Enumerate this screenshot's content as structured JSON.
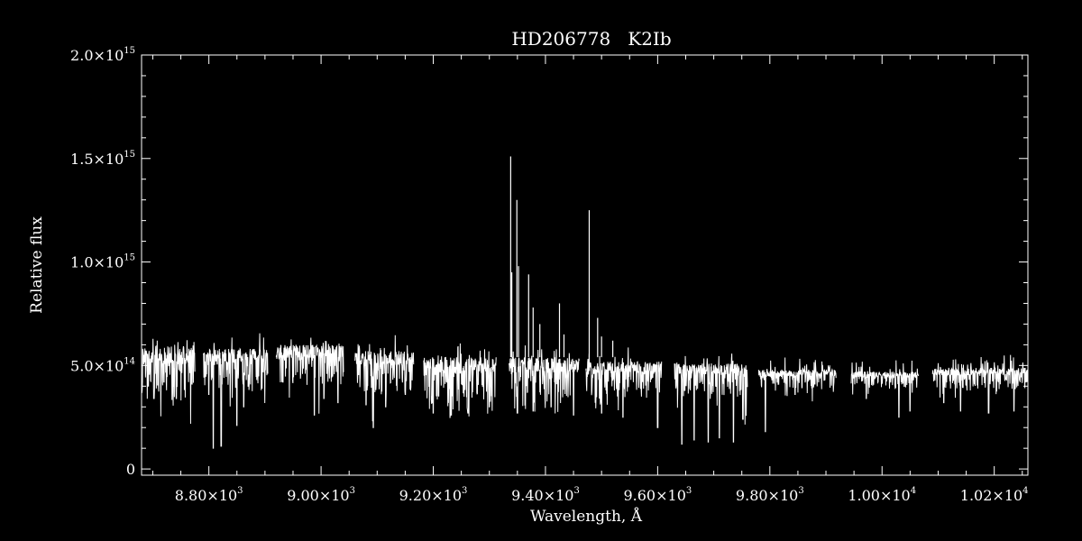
{
  "chart_data": {
    "type": "line",
    "title": "HD206778   K2Ib",
    "xlabel": "Wavelength, Å",
    "ylabel": "Relative flux",
    "xlim": [
      8680,
      10260
    ],
    "ylim": [
      -30000000000000,
      2000000000000000
    ],
    "grid": false,
    "colors": {
      "background": "#000000",
      "foreground": "#ffffff"
    },
    "x_ticks": [
      {
        "value": 8800,
        "mantissa": "8.80×10",
        "exponent": "3"
      },
      {
        "value": 9000,
        "mantissa": "9.00×10",
        "exponent": "3"
      },
      {
        "value": 9200,
        "mantissa": "9.20×10",
        "exponent": "3"
      },
      {
        "value": 9400,
        "mantissa": "9.40×10",
        "exponent": "3"
      },
      {
        "value": 9600,
        "mantissa": "9.60×10",
        "exponent": "3"
      },
      {
        "value": 9800,
        "mantissa": "9.80×10",
        "exponent": "3"
      },
      {
        "value": 10000,
        "mantissa": "1.00×10",
        "exponent": "4"
      },
      {
        "value": 10200,
        "mantissa": "1.02×10",
        "exponent": "4"
      }
    ],
    "y_ticks": [
      {
        "value": 0,
        "mantissa": "0",
        "exponent": ""
      },
      {
        "value": 500000000000000,
        "mantissa": "5.0×10",
        "exponent": "14"
      },
      {
        "value": 1000000000000000,
        "mantissa": "1.0×10",
        "exponent": "15"
      },
      {
        "value": 1500000000000000,
        "mantissa": "1.5×10",
        "exponent": "15"
      },
      {
        "value": 2000000000000000,
        "mantissa": "2.0×10",
        "exponent": "15"
      }
    ],
    "series": [
      {
        "segments": [
          {
            "x_start": 8680,
            "x_end": 8775,
            "continuum": 590000000000000,
            "low": 380000000000000,
            "absorption": [
              {
                "x": 8692,
                "depth": 400000000000000
              },
              {
                "x": 8702,
                "depth": 340000000000000
              },
              {
                "x": 8720,
                "depth": 420000000000000
              },
              {
                "x": 8742,
                "depth": 340000000000000
              },
              {
                "x": 8770,
                "depth": 410000000000000
              }
            ]
          },
          {
            "x_start": 8790,
            "x_end": 8905,
            "continuum": 580000000000000,
            "low": 420000000000000,
            "absorption": [
              {
                "x": 8800,
                "depth": 360000000000000
              },
              {
                "x": 8808,
                "depth": 100000000000000
              },
              {
                "x": 8822,
                "depth": 110000000000000
              },
              {
                "x": 8850,
                "depth": 210000000000000
              },
              {
                "x": 8862,
                "depth": 300000000000000
              }
            ]
          },
          {
            "x_start": 8920,
            "x_end": 9040,
            "continuum": 600000000000000,
            "low": 440000000000000,
            "absorption": [
              {
                "x": 8932,
                "depth": 420000000000000
              },
              {
                "x": 8988,
                "depth": 260000000000000
              },
              {
                "x": 9005,
                "depth": 340000000000000
              },
              {
                "x": 9030,
                "depth": 320000000000000
              }
            ]
          },
          {
            "x_start": 9060,
            "x_end": 9165,
            "continuum": 570000000000000,
            "low": 400000000000000,
            "absorption": [
              {
                "x": 9080,
                "depth": 310000000000000
              },
              {
                "x": 9093,
                "depth": 200000000000000
              },
              {
                "x": 9115,
                "depth": 300000000000000
              },
              {
                "x": 9150,
                "depth": 360000000000000
              }
            ]
          },
          {
            "x_start": 9183,
            "x_end": 9312,
            "continuum": 540000000000000,
            "low": 340000000000000,
            "absorption": [
              {
                "x": 9200,
                "depth": 270000000000000
              },
              {
                "x": 9232,
                "depth": 260000000000000
              },
              {
                "x": 9262,
                "depth": 270000000000000
              },
              {
                "x": 9300,
                "depth": 300000000000000
              }
            ]
          },
          {
            "x_start": 9335,
            "x_end": 9460,
            "continuum": 540000000000000,
            "low": 350000000000000,
            "absorption": [
              {
                "x": 9350,
                "depth": 270000000000000
              },
              {
                "x": 9378,
                "depth": 280000000000000
              },
              {
                "x": 9410,
                "depth": 300000000000000
              },
              {
                "x": 9450,
                "depth": 260000000000000
              }
            ]
          },
          {
            "x_start": 9472,
            "x_end": 9607,
            "continuum": 520000000000000,
            "low": 380000000000000,
            "absorption": [
              {
                "x": 9500,
                "depth": 270000000000000
              },
              {
                "x": 9538,
                "depth": 250000000000000
              },
              {
                "x": 9600,
                "depth": 200000000000000
              }
            ]
          },
          {
            "x_start": 9630,
            "x_end": 9760,
            "continuum": 510000000000000,
            "low": 380000000000000,
            "absorption": [
              {
                "x": 9643,
                "depth": 120000000000000
              },
              {
                "x": 9665,
                "depth": 140000000000000
              },
              {
                "x": 9690,
                "depth": 130000000000000
              },
              {
                "x": 9710,
                "depth": 150000000000000
              },
              {
                "x": 9735,
                "depth": 130000000000000
              },
              {
                "x": 9752,
                "depth": 240000000000000
              }
            ]
          },
          {
            "x_start": 9780,
            "x_end": 9918,
            "continuum": 480000000000000,
            "low": 400000000000000,
            "absorption": [
              {
                "x": 9792,
                "depth": 180000000000000
              },
              {
                "x": 9845,
                "depth": 360000000000000
              }
            ]
          },
          {
            "x_start": 9945,
            "x_end": 10065,
            "continuum": 470000000000000,
            "low": 400000000000000,
            "absorption": [
              {
                "x": 9972,
                "depth": 340000000000000
              },
              {
                "x": 10030,
                "depth": 250000000000000
              },
              {
                "x": 10050,
                "depth": 280000000000000
              }
            ]
          },
          {
            "x_start": 10090,
            "x_end": 10260,
            "continuum": 490000000000000,
            "low": 400000000000000,
            "absorption": [
              {
                "x": 10110,
                "depth": 320000000000000
              },
              {
                "x": 10140,
                "depth": 280000000000000
              },
              {
                "x": 10190,
                "depth": 270000000000000
              },
              {
                "x": 10235,
                "depth": 280000000000000
              }
            ]
          }
        ],
        "emission_spikes": [
          {
            "x": 9338,
            "peak": 1510000000000000
          },
          {
            "x": 9340,
            "peak": 950000000000000
          },
          {
            "x": 9349,
            "peak": 1300000000000000
          },
          {
            "x": 9352,
            "peak": 980000000000000
          },
          {
            "x": 9370,
            "peak": 940000000000000
          },
          {
            "x": 9378,
            "peak": 780000000000000
          },
          {
            "x": 9390,
            "peak": 700000000000000
          },
          {
            "x": 9425,
            "peak": 800000000000000
          },
          {
            "x": 9433,
            "peak": 650000000000000
          },
          {
            "x": 9478,
            "peak": 1250000000000000
          },
          {
            "x": 9493,
            "peak": 730000000000000
          },
          {
            "x": 9500,
            "peak": 640000000000000
          },
          {
            "x": 9520,
            "peak": 620000000000000
          }
        ]
      }
    ]
  }
}
